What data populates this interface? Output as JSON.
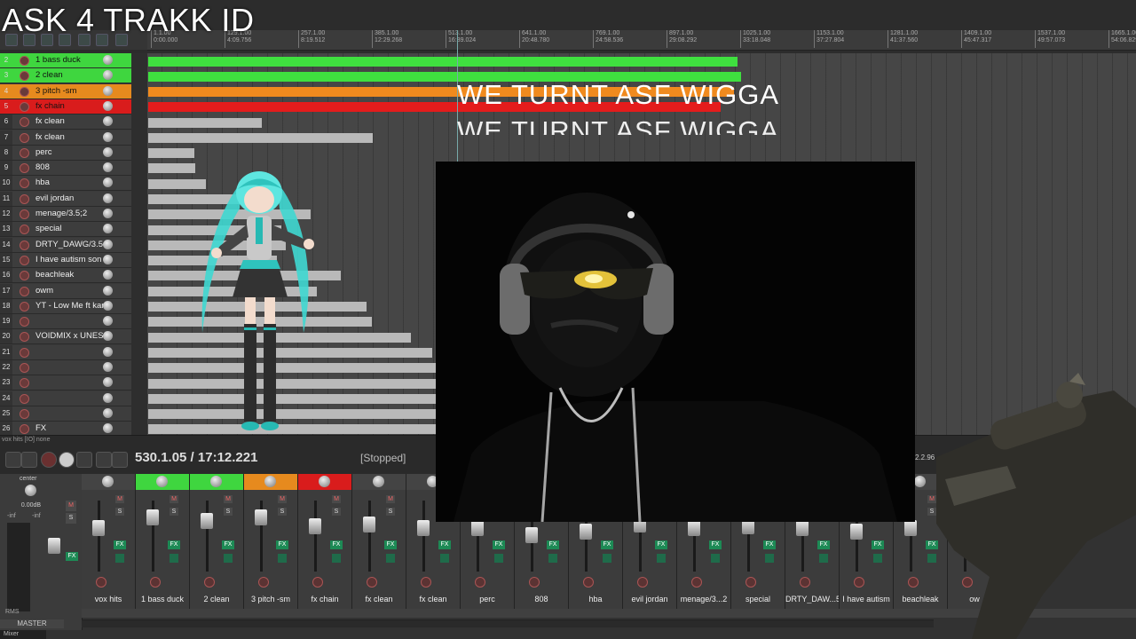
{
  "stream_title": "ASK 4 TRAKK ID",
  "overlay_text": "WE TURNT ASF WIGGA",
  "ruler": [
    {
      "bar": "1.1.00",
      "time": "0:00.000"
    },
    {
      "bar": "129.1.00",
      "time": "4:09.756"
    },
    {
      "bar": "257.1.00",
      "time": "8:19.512"
    },
    {
      "bar": "385.1.00",
      "time": "12:29.268"
    },
    {
      "bar": "513.1.00",
      "time": "16:39.024"
    },
    {
      "bar": "641.1.00",
      "time": "20:48.780"
    },
    {
      "bar": "769.1.00",
      "time": "24:58.536"
    },
    {
      "bar": "897.1.00",
      "time": "29:08.292"
    },
    {
      "bar": "1025.1.00",
      "time": "33:18.048"
    },
    {
      "bar": "1153.1.00",
      "time": "37:27.804"
    },
    {
      "bar": "1281.1.00",
      "time": "41:37.560"
    },
    {
      "bar": "1409.1.00",
      "time": "45:47.317"
    },
    {
      "bar": "1537.1.00",
      "time": "49:57.073"
    },
    {
      "bar": "1665.1.00",
      "time": "54:06.829"
    }
  ],
  "tracks": [
    {
      "num": "2",
      "name": "1 bass duck",
      "color": "#3fd63f"
    },
    {
      "num": "3",
      "name": "2 clean",
      "color": "#3fd63f"
    },
    {
      "num": "4",
      "name": "3 pitch -sm",
      "color": "#e68a1e"
    },
    {
      "num": "5",
      "name": "fx chain",
      "color": "#d91c1c"
    },
    {
      "num": "6",
      "name": "fx clean",
      "color": ""
    },
    {
      "num": "7",
      "name": "fx clean",
      "color": ""
    },
    {
      "num": "8",
      "name": "perc",
      "color": ""
    },
    {
      "num": "9",
      "name": "808",
      "color": ""
    },
    {
      "num": "10",
      "name": "hba",
      "color": ""
    },
    {
      "num": "11",
      "name": "evil jordan",
      "color": ""
    },
    {
      "num": "12",
      "name": "menage/3.5;2",
      "color": ""
    },
    {
      "num": "13",
      "name": "special",
      "color": ""
    },
    {
      "num": "14",
      "name": "DRTY_DAWG/3.5",
      "color": ""
    },
    {
      "num": "15",
      "name": "I have autism son",
      "color": ""
    },
    {
      "num": "16",
      "name": "beachleak",
      "color": ""
    },
    {
      "num": "17",
      "name": "owm",
      "color": ""
    },
    {
      "num": "18",
      "name": "YT - Low Me ft kar",
      "color": ""
    },
    {
      "num": "19",
      "name": "",
      "color": ""
    },
    {
      "num": "20",
      "name": "VOIDMIX x UNESS",
      "color": ""
    },
    {
      "num": "21",
      "name": "",
      "color": ""
    },
    {
      "num": "22",
      "name": "",
      "color": ""
    },
    {
      "num": "23",
      "name": "",
      "color": ""
    },
    {
      "num": "24",
      "name": "",
      "color": ""
    },
    {
      "num": "25",
      "name": "",
      "color": ""
    },
    {
      "num": "26",
      "name": "FX",
      "color": ""
    }
  ],
  "transport": {
    "status_line": "vox hits [IO] none",
    "time": "530.1.05 / 17:12.221",
    "state": "[Stopped]",
    "right_value": "2.2.96"
  },
  "master": {
    "pan_label": "center",
    "volume": "0.00dB",
    "peak_left": "-inf",
    "peak_right": "-inf",
    "label": "MASTER",
    "rms": "RMS",
    "tab": "Mixer"
  },
  "mixer_strips": [
    {
      "name": "vox hits",
      "num": "1",
      "color": ""
    },
    {
      "name": "1 bass duck",
      "num": "2",
      "color": "#3fd63f"
    },
    {
      "name": "2 clean",
      "num": "3",
      "color": "#3fd63f"
    },
    {
      "name": "3 pitch -sm",
      "num": "4",
      "color": "#e68a1e"
    },
    {
      "name": "fx chain",
      "num": "5",
      "color": "#d91c1c"
    },
    {
      "name": "fx clean",
      "num": "6",
      "color": ""
    },
    {
      "name": "fx clean",
      "num": "7",
      "color": ""
    },
    {
      "name": "perc",
      "num": "8",
      "color": ""
    },
    {
      "name": "808",
      "num": "9",
      "color": ""
    },
    {
      "name": "hba",
      "num": "10",
      "color": ""
    },
    {
      "name": "evil jordan",
      "num": "11",
      "color": ""
    },
    {
      "name": "menage/3...2",
      "num": "12",
      "color": ""
    },
    {
      "name": "special",
      "num": "13",
      "color": ""
    },
    {
      "name": "DRTY_DAW...5",
      "num": "14",
      "color": ""
    },
    {
      "name": "I have autism",
      "num": "15",
      "color": ""
    },
    {
      "name": "beachleak",
      "num": "16",
      "color": ""
    },
    {
      "name": "ow",
      "num": "17",
      "color": ""
    }
  ],
  "strip_labels": {
    "mute": "M",
    "solo": "S",
    "fx": "FX",
    "inf": "-inf"
  }
}
